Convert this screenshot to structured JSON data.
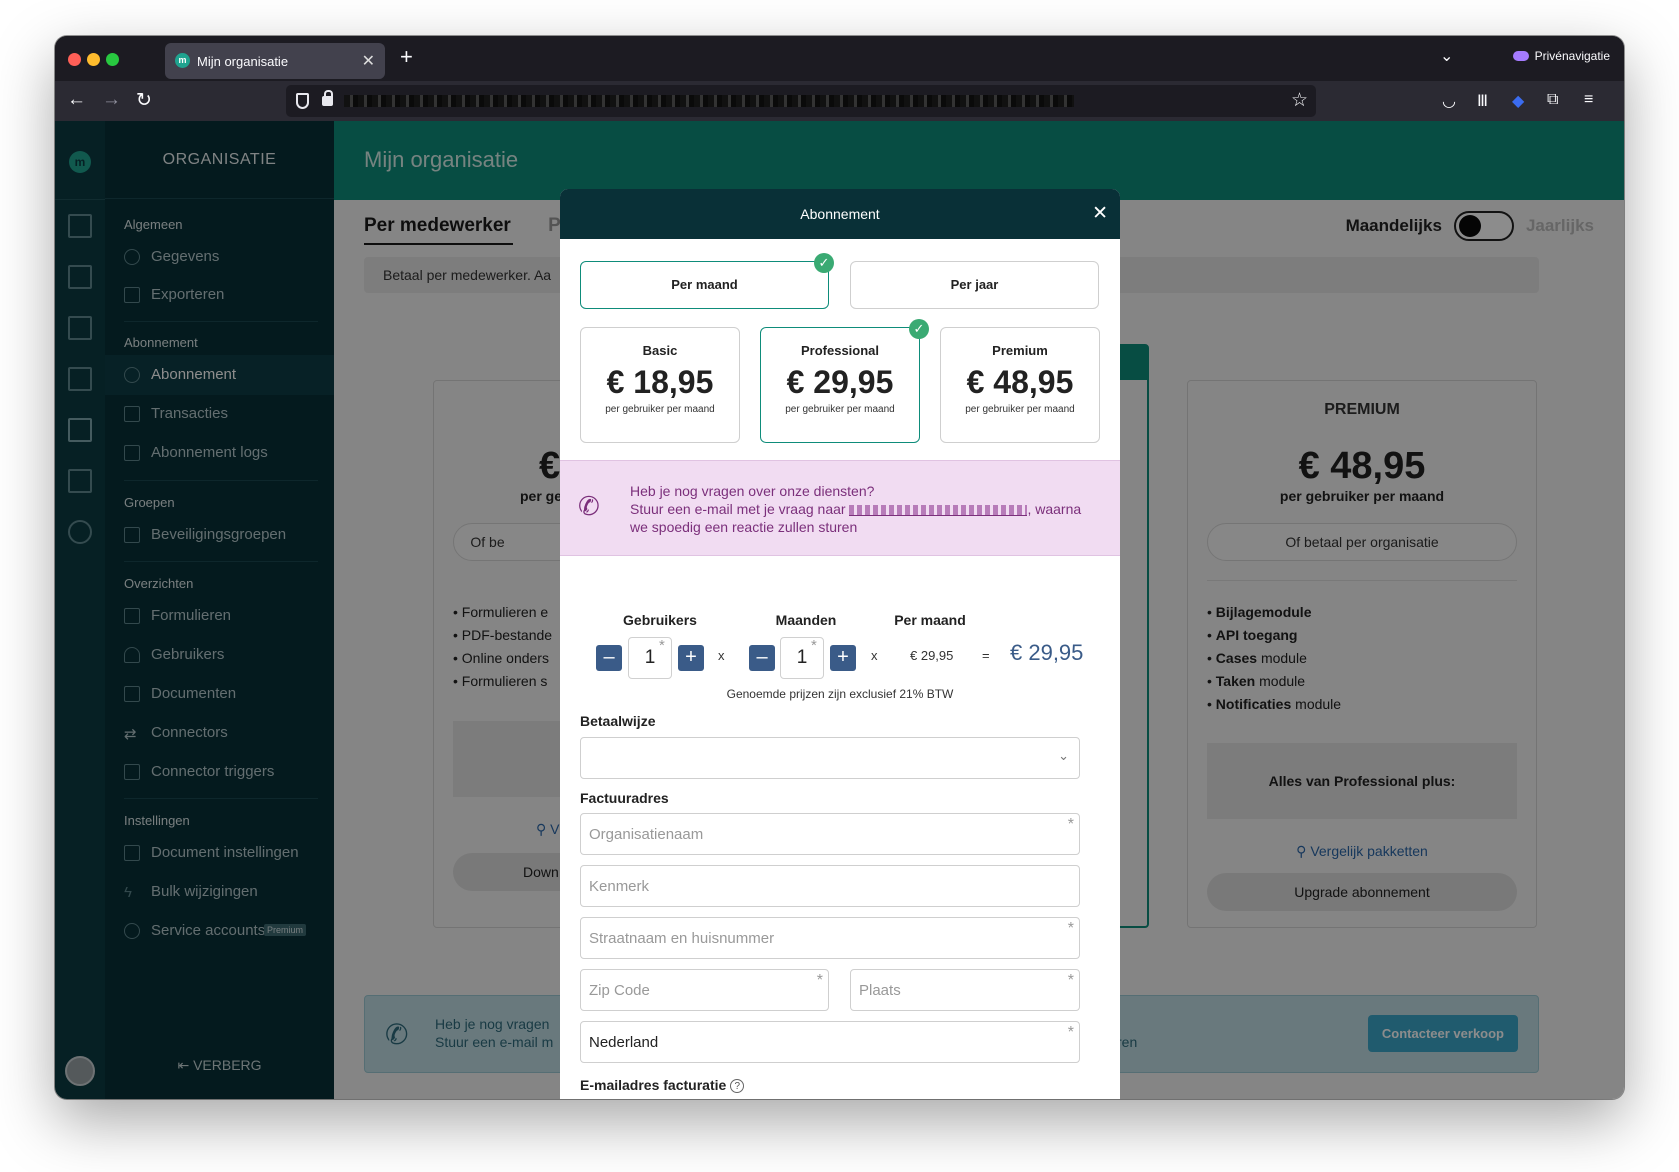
{
  "browser": {
    "tab_title": "Mijn organisatie",
    "tab_favicon": "m",
    "private_label": "Privénavigatie"
  },
  "sidebar": {
    "brand": "ORGANISATIE",
    "sections": [
      {
        "header": "Algemeen",
        "items": [
          "Gegevens",
          "Exporteren"
        ]
      },
      {
        "header": "Abonnement",
        "items": [
          "Abonnement",
          "Transacties",
          "Abonnement logs"
        ]
      },
      {
        "header": "Groepen",
        "items": [
          "Beveiligingsgroepen"
        ]
      },
      {
        "header": "Overzichten",
        "items": [
          "Formulieren",
          "Gebruikers",
          "Documenten",
          "Connectors",
          "Connector triggers"
        ]
      },
      {
        "header": "Instellingen",
        "items": [
          "Document instellingen",
          "Bulk wijzigingen",
          "Service accounts"
        ]
      }
    ],
    "premium_badge": "Premium",
    "hide_label": "VERBERG"
  },
  "main": {
    "page_title": "Mijn organisatie",
    "tab_active": "Per medewerker",
    "tab_next": "P",
    "toggle_left": "Maandelijks",
    "toggle_right": "Jaarlijks",
    "info_text": "Betaal per medewerker. Aa",
    "left_card": {
      "price_partial": "€",
      "unit_partial": "per ge",
      "pill": "Of be",
      "features": [
        "Formulieren e",
        "PDF-bestande",
        "Online onders",
        "Formulieren s"
      ],
      "compare_partial": "V",
      "button_partial": "Down"
    },
    "premium_card": {
      "title": "PREMIUM",
      "price": "€ 48,95",
      "unit": "per gebruiker per maand",
      "pill": "Of betaal per organisatie",
      "features": [
        {
          "bold": "Bijlagemodule",
          "rest": ""
        },
        {
          "bold": "API toegang",
          "rest": ""
        },
        {
          "bold": "Cases",
          "rest": " module"
        },
        {
          "bold": "Taken",
          "rest": " module"
        },
        {
          "bold": "Notificaties",
          "rest": " module"
        }
      ],
      "grey_box": "Alles van Professional plus:",
      "compare": "Vergelijk pakketten",
      "button": "Upgrade abonnement"
    },
    "bottom_banner": {
      "line1": "Heb je nog vragen",
      "line2": "Stuur een e-mail m",
      "line2_end": "ren",
      "button": "Contacteer verkoop"
    }
  },
  "modal": {
    "title": "Abonnement",
    "periods": [
      {
        "label": "Per maand",
        "selected": true
      },
      {
        "label": "Per jaar",
        "selected": false
      }
    ],
    "plans": [
      {
        "name": "Basic",
        "price": "€ 18,95",
        "unit": "per gebruiker per maand",
        "selected": false
      },
      {
        "name": "Professional",
        "price": "€ 29,95",
        "unit": "per gebruiker per maand",
        "selected": true
      },
      {
        "name": "Premium",
        "price": "€ 48,95",
        "unit": "per gebruiker per maand",
        "selected": false
      }
    ],
    "question": {
      "line1": "Heb je nog vragen over onze diensten?",
      "line2_start": "Stuur een e-mail met je vraag naar",
      "line2_end": ", waarna",
      "line3": "we spoedig een reactie zullen sturen"
    },
    "calc": {
      "users_label": "Gebruikers",
      "months_label": "Maanden",
      "per_month_label": "Per maand",
      "users_value": "1",
      "months_value": "1",
      "times": "x",
      "equals": "=",
      "unit_price": "€ 29,95",
      "total": "€ 29,95",
      "vat_note": "Genoemde prijzen zijn exclusief 21% BTW"
    },
    "form": {
      "payment_label": "Betaalwijze",
      "payment_value": "",
      "invoice_label": "Factuuradres",
      "org_placeholder": "Organisatienaam",
      "ref_placeholder": "Kenmerk",
      "street_placeholder": "Straatnaam en huisnummer",
      "zip_placeholder": "Zip Code",
      "city_placeholder": "Plaats",
      "country_value": "Nederland",
      "email_label": "E-mailadres facturatie",
      "email_value": ""
    }
  }
}
